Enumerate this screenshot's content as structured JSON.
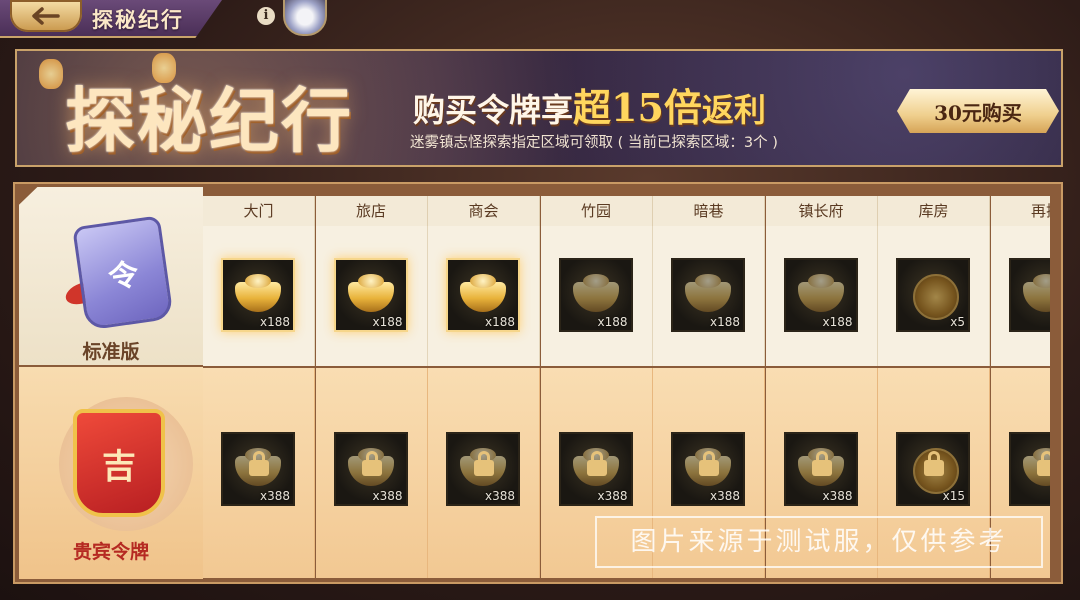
{
  "topbar": {
    "page_label": "探秘纪行",
    "info_glyph": "i",
    "back_icon": "back-arrow-icon",
    "avatar_icon": "porcelain-avatar-icon"
  },
  "banner": {
    "title": "探秘纪行",
    "promo_prefix": "购买令牌享",
    "promo_highlight": "超15倍",
    "promo_suffix": "返利",
    "subtitle": "迷雾镇志怪探索指定区域可领取 ( 当前已探索区域：3个 )",
    "buy_label": "30元购买"
  },
  "tiers": {
    "standard": {
      "label": "标准版",
      "token_glyph": "令",
      "icon": "standard-token-icon"
    },
    "vip": {
      "label": "贵宾令牌",
      "token_glyph": "吉",
      "icon": "vip-token-icon"
    }
  },
  "areas": [
    {
      "name": "大门",
      "std": {
        "icon": "gold-ingot-icon",
        "qty": "x188",
        "claimed": true
      },
      "vip": {
        "icon": "gold-ingot-icon",
        "qty": "x388",
        "locked": true
      }
    },
    {
      "name": "旅店",
      "std": {
        "icon": "gold-ingot-icon",
        "qty": "x188",
        "claimed": true
      },
      "vip": {
        "icon": "gold-ingot-icon",
        "qty": "x388",
        "locked": true
      }
    },
    {
      "name": "商会",
      "std": {
        "icon": "gold-ingot-icon",
        "qty": "x188",
        "claimed": true
      },
      "vip": {
        "icon": "gold-ingot-icon",
        "qty": "x388",
        "locked": true
      }
    },
    {
      "name": "竹园",
      "std": {
        "icon": "gold-ingot-icon",
        "qty": "x188",
        "claimed": false
      },
      "vip": {
        "icon": "gold-ingot-icon",
        "qty": "x388",
        "locked": true
      }
    },
    {
      "name": "暗巷",
      "std": {
        "icon": "gold-ingot-icon",
        "qty": "x188",
        "claimed": false
      },
      "vip": {
        "icon": "gold-ingot-icon",
        "qty": "x388",
        "locked": true
      }
    },
    {
      "name": "镇长府",
      "std": {
        "icon": "gold-ingot-icon",
        "qty": "x188",
        "claimed": false
      },
      "vip": {
        "icon": "gold-ingot-icon",
        "qty": "x388",
        "locked": true
      }
    },
    {
      "name": "库房",
      "std": {
        "icon": "coin-icon",
        "qty": "x5",
        "claimed": false
      },
      "vip": {
        "icon": "coin-icon",
        "qty": "x15",
        "locked": true
      }
    },
    {
      "name": "再探",
      "std": {
        "icon": "gold-ingot-icon",
        "qty": "",
        "claimed": false
      },
      "vip": {
        "icon": "gold-ingot-icon",
        "qty": "",
        "locked": true
      }
    }
  ],
  "watermark": "图片来源于测试服，仅供参考"
}
